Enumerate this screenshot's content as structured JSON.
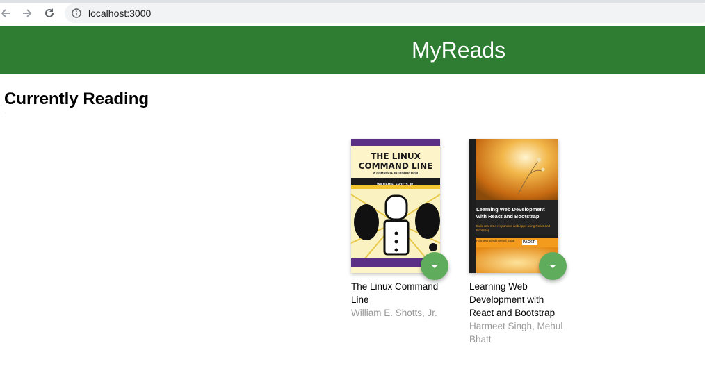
{
  "browser": {
    "url": "localhost:3000",
    "back_icon": "arrow-left-icon",
    "forward_icon": "arrow-right-icon",
    "reload_icon": "reload-icon",
    "info_icon": "info-icon"
  },
  "header": {
    "title": "MyReads",
    "color": "#2e7d32"
  },
  "shelves": [
    {
      "title": "Currently Reading",
      "books": [
        {
          "title": "The Linux Command Line",
          "authors": "William E. Shotts, Jr.",
          "cover": {
            "title_line1": "THE LINUX",
            "title_line2": "COMMAND LINE",
            "tagline": "A COMPLETE INTRODUCTION",
            "author": "WILLIAM E. SHOTTS, JR."
          }
        },
        {
          "title": "Learning Web Development with React and Bootstrap",
          "authors": "Harmeet Singh, Mehul Bhatt",
          "cover": {
            "title": "Learning Web Development with React and Bootstrap",
            "subtitle": "Build real-time responsive web apps using React and Bootstrap",
            "authors": "Harmeet Singh Mehul Bhatt",
            "publisher": "PACKT"
          }
        }
      ]
    }
  ],
  "colors": {
    "shelf_changer": "#60ac5d",
    "author_text": "#999999"
  }
}
